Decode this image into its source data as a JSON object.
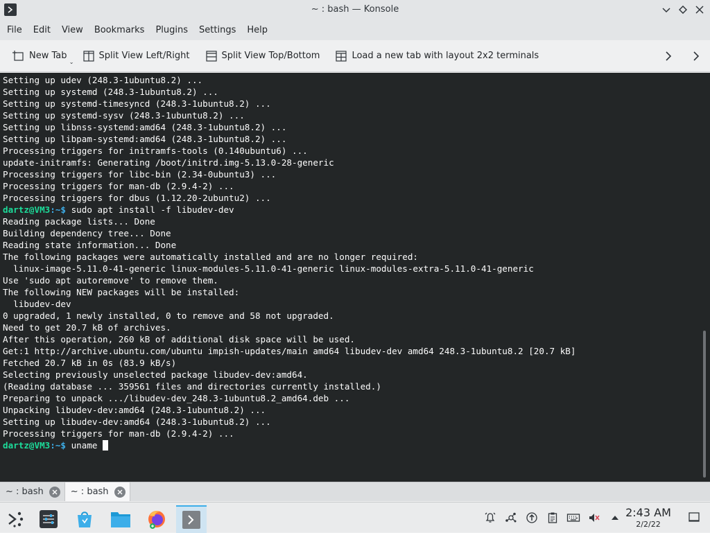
{
  "window": {
    "title": "~ : bash — Konsole"
  },
  "menu": [
    "File",
    "Edit",
    "View",
    "Bookmarks",
    "Plugins",
    "Settings",
    "Help"
  ],
  "toolbar": {
    "new_tab": "New Tab",
    "split_lr": "Split View Left/Right",
    "split_tb": "Split View Top/Bottom",
    "layout_2x2": "Load a new tab with layout 2x2 terminals"
  },
  "terminal": {
    "prompt_user": "dartz@VM3",
    "prompt_path": ":~",
    "prompt_symbol": "$",
    "lines": [
      {
        "type": "out",
        "text": "Setting up udev (248.3-1ubuntu8.2) ..."
      },
      {
        "type": "out",
        "text": "Setting up systemd (248.3-1ubuntu8.2) ..."
      },
      {
        "type": "out",
        "text": "Setting up systemd-timesyncd (248.3-1ubuntu8.2) ..."
      },
      {
        "type": "out",
        "text": "Setting up systemd-sysv (248.3-1ubuntu8.2) ..."
      },
      {
        "type": "out",
        "text": "Setting up libnss-systemd:amd64 (248.3-1ubuntu8.2) ..."
      },
      {
        "type": "out",
        "text": "Setting up libpam-systemd:amd64 (248.3-1ubuntu8.2) ..."
      },
      {
        "type": "out",
        "text": "Processing triggers for initramfs-tools (0.140ubuntu6) ..."
      },
      {
        "type": "out",
        "text": "update-initramfs: Generating /boot/initrd.img-5.13.0-28-generic"
      },
      {
        "type": "out",
        "text": "Processing triggers for libc-bin (2.34-0ubuntu3) ..."
      },
      {
        "type": "out",
        "text": "Processing triggers for man-db (2.9.4-2) ..."
      },
      {
        "type": "out",
        "text": "Processing triggers for dbus (1.12.20-2ubuntu2) ..."
      },
      {
        "type": "cmd",
        "text": " sudo apt install -f libudev-dev"
      },
      {
        "type": "out",
        "text": "Reading package lists... Done"
      },
      {
        "type": "out",
        "text": "Building dependency tree... Done"
      },
      {
        "type": "out",
        "text": "Reading state information... Done"
      },
      {
        "type": "out",
        "text": "The following packages were automatically installed and are no longer required:"
      },
      {
        "type": "out",
        "text": "  linux-image-5.11.0-41-generic linux-modules-5.11.0-41-generic linux-modules-extra-5.11.0-41-generic"
      },
      {
        "type": "out",
        "text": "Use 'sudo apt autoremove' to remove them."
      },
      {
        "type": "out",
        "text": "The following NEW packages will be installed:"
      },
      {
        "type": "out",
        "text": "  libudev-dev"
      },
      {
        "type": "out",
        "text": "0 upgraded, 1 newly installed, 0 to remove and 58 not upgraded."
      },
      {
        "type": "out",
        "text": "Need to get 20.7 kB of archives."
      },
      {
        "type": "out",
        "text": "After this operation, 260 kB of additional disk space will be used."
      },
      {
        "type": "out",
        "text": "Get:1 http://archive.ubuntu.com/ubuntu impish-updates/main amd64 libudev-dev amd64 248.3-1ubuntu8.2 [20.7 kB]"
      },
      {
        "type": "out",
        "text": "Fetched 20.7 kB in 0s (83.9 kB/s)"
      },
      {
        "type": "out",
        "text": "Selecting previously unselected package libudev-dev:amd64."
      },
      {
        "type": "out",
        "text": "(Reading database ... 359561 files and directories currently installed.)"
      },
      {
        "type": "out",
        "text": "Preparing to unpack .../libudev-dev_248.3-1ubuntu8.2_amd64.deb ..."
      },
      {
        "type": "out",
        "text": "Unpacking libudev-dev:amd64 (248.3-1ubuntu8.2) ..."
      },
      {
        "type": "out",
        "text": "Setting up libudev-dev:amd64 (248.3-1ubuntu8.2) ..."
      },
      {
        "type": "out",
        "text": "Processing triggers for man-db (2.9.4-2) ..."
      },
      {
        "type": "cmd",
        "text": " uname ",
        "cursor": true
      }
    ]
  },
  "tabs": [
    {
      "label": "~ : bash",
      "active": false
    },
    {
      "label": "~ : bash",
      "active": true
    }
  ],
  "taskbar": {
    "clock_time": "2:43 AM",
    "clock_date": "2/2/22"
  },
  "colors": {
    "terminal_bg": "#232627",
    "terminal_fg": "#fcfcfc",
    "prompt_user": "#1cdc9a",
    "prompt_path": "#3daee9",
    "accent": "#3daee9"
  }
}
